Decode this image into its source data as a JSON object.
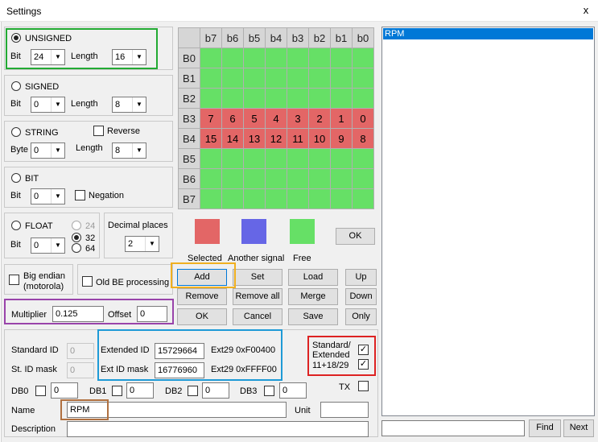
{
  "window": {
    "title": "Settings",
    "close_glyph": "x"
  },
  "unsigned": {
    "label": "UNSIGNED",
    "selected": true,
    "bit_label": "Bit",
    "bit_value": "24",
    "length_label": "Length",
    "length_value": "16"
  },
  "signed": {
    "label": "SIGNED",
    "selected": false,
    "bit_label": "Bit",
    "bit_value": "0",
    "length_label": "Length",
    "length_value": "8"
  },
  "string": {
    "label": "STRING",
    "selected": false,
    "reverse_label": "Reverse",
    "reverse_checked": false,
    "byte_label": "Byte",
    "byte_value": "0",
    "length_label": "Length",
    "length_value": "8"
  },
  "bit": {
    "label": "BIT",
    "selected": false,
    "bit_label": "Bit",
    "bit_value": "0",
    "negation_label": "Negation",
    "negation_checked": false
  },
  "float": {
    "label": "FLOAT",
    "selected": false,
    "bit_label": "Bit",
    "bit_value": "0",
    "size_24": "24",
    "size_32": "32",
    "size_64": "64",
    "selected_size": "32",
    "decimal_label": "Decimal places",
    "decimal_value": "2"
  },
  "endian": {
    "big_endian_label": "Big endian (motorola)",
    "big_endian_checked": false,
    "old_be_label": "Old BE processing",
    "old_be_checked": false
  },
  "multiplier": {
    "label": "Multiplier",
    "value": "0.125",
    "offset_label": "Offset",
    "offset_value": "0"
  },
  "grid": {
    "col_headers": [
      "b7",
      "b6",
      "b5",
      "b4",
      "b3",
      "b2",
      "b1",
      "b0"
    ],
    "rows": [
      {
        "label": "B0",
        "state": "free",
        "cells": [
          "",
          "",
          "",
          "",
          "",
          "",
          "",
          ""
        ]
      },
      {
        "label": "B1",
        "state": "free",
        "cells": [
          "",
          "",
          "",
          "",
          "",
          "",
          "",
          ""
        ]
      },
      {
        "label": "B2",
        "state": "free",
        "cells": [
          "",
          "",
          "",
          "",
          "",
          "",
          "",
          ""
        ]
      },
      {
        "label": "B3",
        "state": "selected",
        "cells": [
          "7",
          "6",
          "5",
          "4",
          "3",
          "2",
          "1",
          "0"
        ]
      },
      {
        "label": "B4",
        "state": "selected",
        "cells": [
          "15",
          "14",
          "13",
          "12",
          "11",
          "10",
          "9",
          "8"
        ]
      },
      {
        "label": "B5",
        "state": "free",
        "cells": [
          "",
          "",
          "",
          "",
          "",
          "",
          "",
          ""
        ]
      },
      {
        "label": "B6",
        "state": "free",
        "cells": [
          "",
          "",
          "",
          "",
          "",
          "",
          "",
          ""
        ]
      },
      {
        "label": "B7",
        "state": "free",
        "cells": [
          "",
          "",
          "",
          "",
          "",
          "",
          "",
          ""
        ]
      }
    ]
  },
  "legend": {
    "selected_label": "Selected",
    "another_label": "Another signal",
    "free_label": "Free",
    "ok_label": "OK"
  },
  "colors": {
    "selected": "#e36666",
    "another_signal": "#6666e6",
    "free": "#66e066",
    "selection_blue": "#0078d7",
    "highlight_green": "#22aa33",
    "highlight_purple": "#9944aa",
    "highlight_orange": "#f0b020",
    "highlight_blue": "#1e9ad6",
    "highlight_red": "#dd2222",
    "highlight_brown": "#b07040"
  },
  "buttons": {
    "add": "Add",
    "set": "Set",
    "load": "Load",
    "up": "Up",
    "remove": "Remove",
    "remove_all": "Remove all",
    "merge": "Merge",
    "down": "Down",
    "ok": "OK",
    "cancel": "Cancel",
    "save": "Save",
    "only": "Only"
  },
  "ids": {
    "standard_id_label": "Standard ID",
    "standard_id_value": "0",
    "st_mask_label": "St. ID mask",
    "st_mask_value": "0",
    "extended_id_label": "Extended ID",
    "extended_id_value": "15729664",
    "ext29_id": "Ext29 0xF00400",
    "ext_mask_label": "Ext ID mask",
    "ext_mask_value": "16776960",
    "ext29_mask": "Ext29 0xFFFF00",
    "std_ext_label": "Standard/ Extended",
    "std_ext_checked": true,
    "mixed_label": "11+18/29",
    "mixed_checked": true
  },
  "db": {
    "db0_label": "DB0",
    "db0_value": "0",
    "db1_label": "DB1",
    "db1_value": "0",
    "db2_label": "DB2",
    "db2_value": "0",
    "db3_label": "DB3",
    "db3_value": "0",
    "tx_label": "TX"
  },
  "name": {
    "label": "Name",
    "value": "RPM",
    "unit_label": "Unit",
    "unit_value": ""
  },
  "description": {
    "label": "Description",
    "value": ""
  },
  "signals": {
    "items": [
      "RPM"
    ],
    "selected": "RPM"
  },
  "search": {
    "value": "",
    "find_label": "Find",
    "next_label": "Next"
  }
}
